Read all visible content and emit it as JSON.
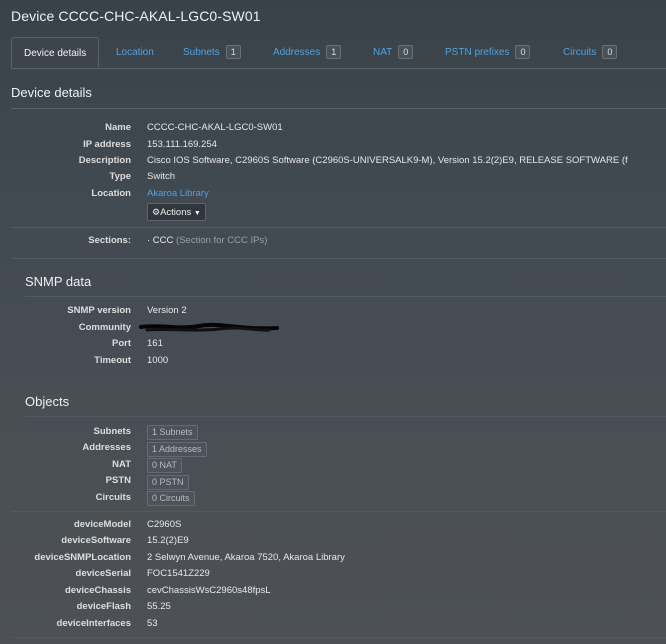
{
  "page": {
    "title": "Device CCCC-CHC-AKAL-LGC0-SW01"
  },
  "tabs": [
    {
      "label": "Device details",
      "count": ""
    },
    {
      "label": "Location",
      "count": ""
    },
    {
      "label": "Subnets",
      "count": "1"
    },
    {
      "label": "Addresses",
      "count": "1"
    },
    {
      "label": "NAT",
      "count": "0"
    },
    {
      "label": "PSTN prefixes",
      "count": "0"
    },
    {
      "label": "Circuits",
      "count": "0"
    }
  ],
  "details": {
    "title": "Device details",
    "name_label": "Name",
    "name": "CCCC-CHC-AKAL-LGC0-SW01",
    "ip_label": "IP address",
    "ip": "153.111.169.254",
    "description_label": "Description",
    "description": "Cisco IOS Software, C2960S Software (C2960S-UNIVERSALK9-M), Version 15.2(2)E9, RELEASE SOFTWARE (f",
    "type_label": "Type",
    "type": "Switch",
    "location_label": "Location",
    "location": "Akaroa Library",
    "actions_label": "Actions",
    "sections_label": "Sections:",
    "section_bullet": "· CCC",
    "section_note": "(Section for CCC IPs)"
  },
  "snmp": {
    "title": "SNMP data",
    "version_label": "SNMP version",
    "version": "Version 2",
    "community_label": "Community",
    "port_label": "Port",
    "port": "161",
    "timeout_label": "Timeout",
    "timeout": "1000"
  },
  "objects": {
    "title": "Objects",
    "subnets_label": "Subnets",
    "subnets": "1 Subnets",
    "addresses_label": "Addresses",
    "addresses": "1 Addresses",
    "nat_label": "NAT",
    "nat": "0 NAT",
    "pstn_label": "PSTN",
    "pstn": "0 PSTN",
    "circuits_label": "Circuits",
    "circuits": "0 Circuits"
  },
  "custom": {
    "model_label": "deviceModel",
    "model": "C2960S",
    "software_label": "deviceSoftware",
    "software": "15.2(2)E9",
    "snmp_location_label": "deviceSNMPLocation",
    "snmp_location": "2 Selwyn Avenue, Akaroa 7520, Akaroa Library",
    "serial_label": "deviceSerial",
    "serial": "FOC1541Z229",
    "chassis_label": "deviceChassis",
    "chassis": "cevChassisWsC2960s48fpsL",
    "flash_label": "deviceFlash",
    "flash": "55.25",
    "interfaces_label": "deviceInterfaces",
    "interfaces": "53"
  },
  "icons": {
    "actions": "gears-icon",
    "caret": "caret-down-icon",
    "redaction": "redaction-scribble"
  }
}
